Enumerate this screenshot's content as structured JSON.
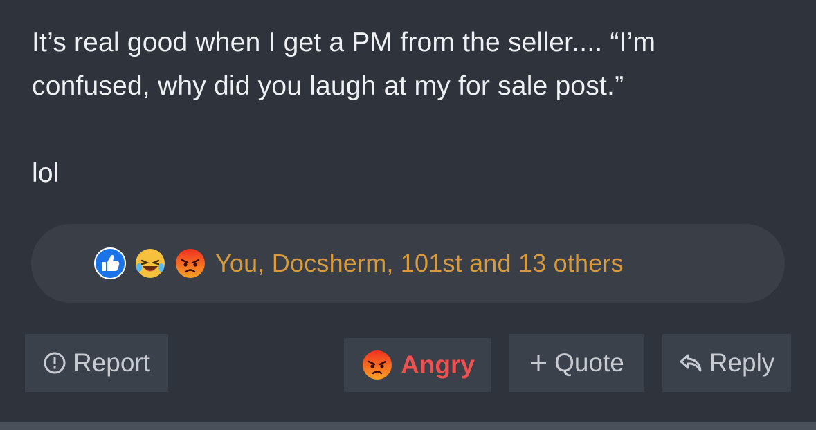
{
  "post": {
    "line1": "It’s real good when I get a PM from the seller.... “I’m",
    "line2": "confused, why did you laugh at my for sale post.”",
    "line3": "lol"
  },
  "reactions": {
    "icons": [
      "like-icon",
      "laugh-icon",
      "angry-icon"
    ],
    "summary": "You, Docsherm, 101st and 13 others"
  },
  "actions": {
    "report_label": "Report",
    "angry_label": "Angry",
    "quote_label": "Quote",
    "reply_label": "Reply"
  },
  "colors": {
    "background": "#2f343c",
    "reactions_text": "#d79a3c",
    "angry_text": "#ef5050",
    "button_bg": "#3b414a"
  }
}
